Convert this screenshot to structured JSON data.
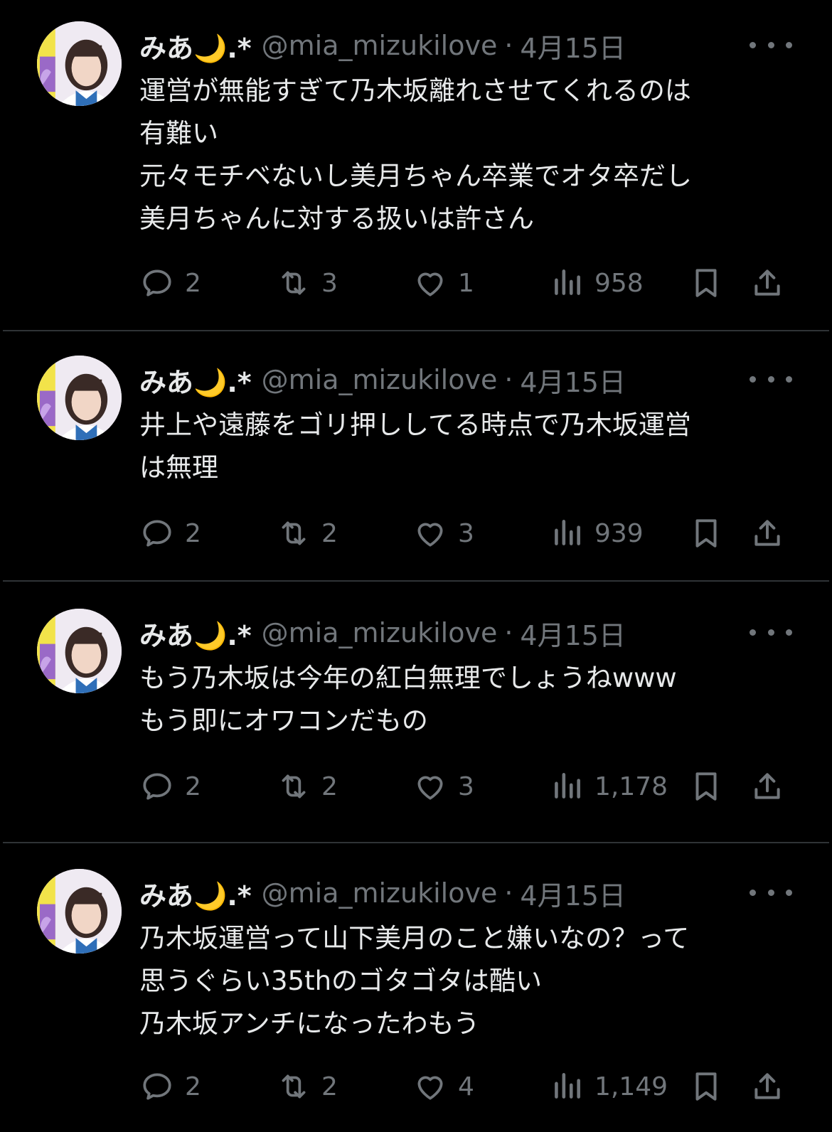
{
  "tweets": [
    {
      "display_name": "みあ🌙.*",
      "handle": "@mia_mizukilove",
      "separator": "·",
      "date": "4月15日",
      "lines": [
        "運営が無能すぎて乃木坂離れさせてくれるのは",
        "有難い",
        "元々モチベないし美月ちゃん卒業でオタ卒だし",
        "美月ちゃんに対する扱いは許さん"
      ],
      "replies": "2",
      "reposts": "3",
      "likes": "1",
      "views": "958"
    },
    {
      "display_name": "みあ🌙.*",
      "handle": "@mia_mizukilove",
      "separator": "·",
      "date": "4月15日",
      "lines": [
        "井上や遠藤をゴリ押ししてる時点で乃木坂運営",
        "は無理"
      ],
      "replies": "2",
      "reposts": "2",
      "likes": "3",
      "views": "939"
    },
    {
      "display_name": "みあ🌙.*",
      "handle": "@mia_mizukilove",
      "separator": "·",
      "date": "4月15日",
      "lines": [
        "もう乃木坂は今年の紅白無理でしょうねwww",
        "もう即にオワコンだもの"
      ],
      "replies": "2",
      "reposts": "2",
      "likes": "3",
      "views": "1,178"
    },
    {
      "display_name": "みあ🌙.*",
      "handle": "@mia_mizukilove",
      "separator": "·",
      "date": "4月15日",
      "lines": [
        "乃木坂運営って山下美月のこと嫌いなの？って",
        "思うぐらい35thのゴタゴタは酷い",
        "乃木坂アンチになったわもう"
      ],
      "replies": "2",
      "reposts": "2",
      "likes": "4",
      "views": "1,149"
    }
  ],
  "colors": {
    "background": "#000000",
    "primary_text": "#e7e9ea",
    "secondary_text": "#71767b",
    "divider": "#2f3336"
  },
  "icons": {
    "reply": "speech-bubble-icon",
    "repost": "repost-arrows-icon",
    "like": "heart-icon",
    "views": "bar-chart-icon",
    "bookmark": "bookmark-icon",
    "share": "share-upload-icon",
    "more": "more-dots-icon"
  }
}
